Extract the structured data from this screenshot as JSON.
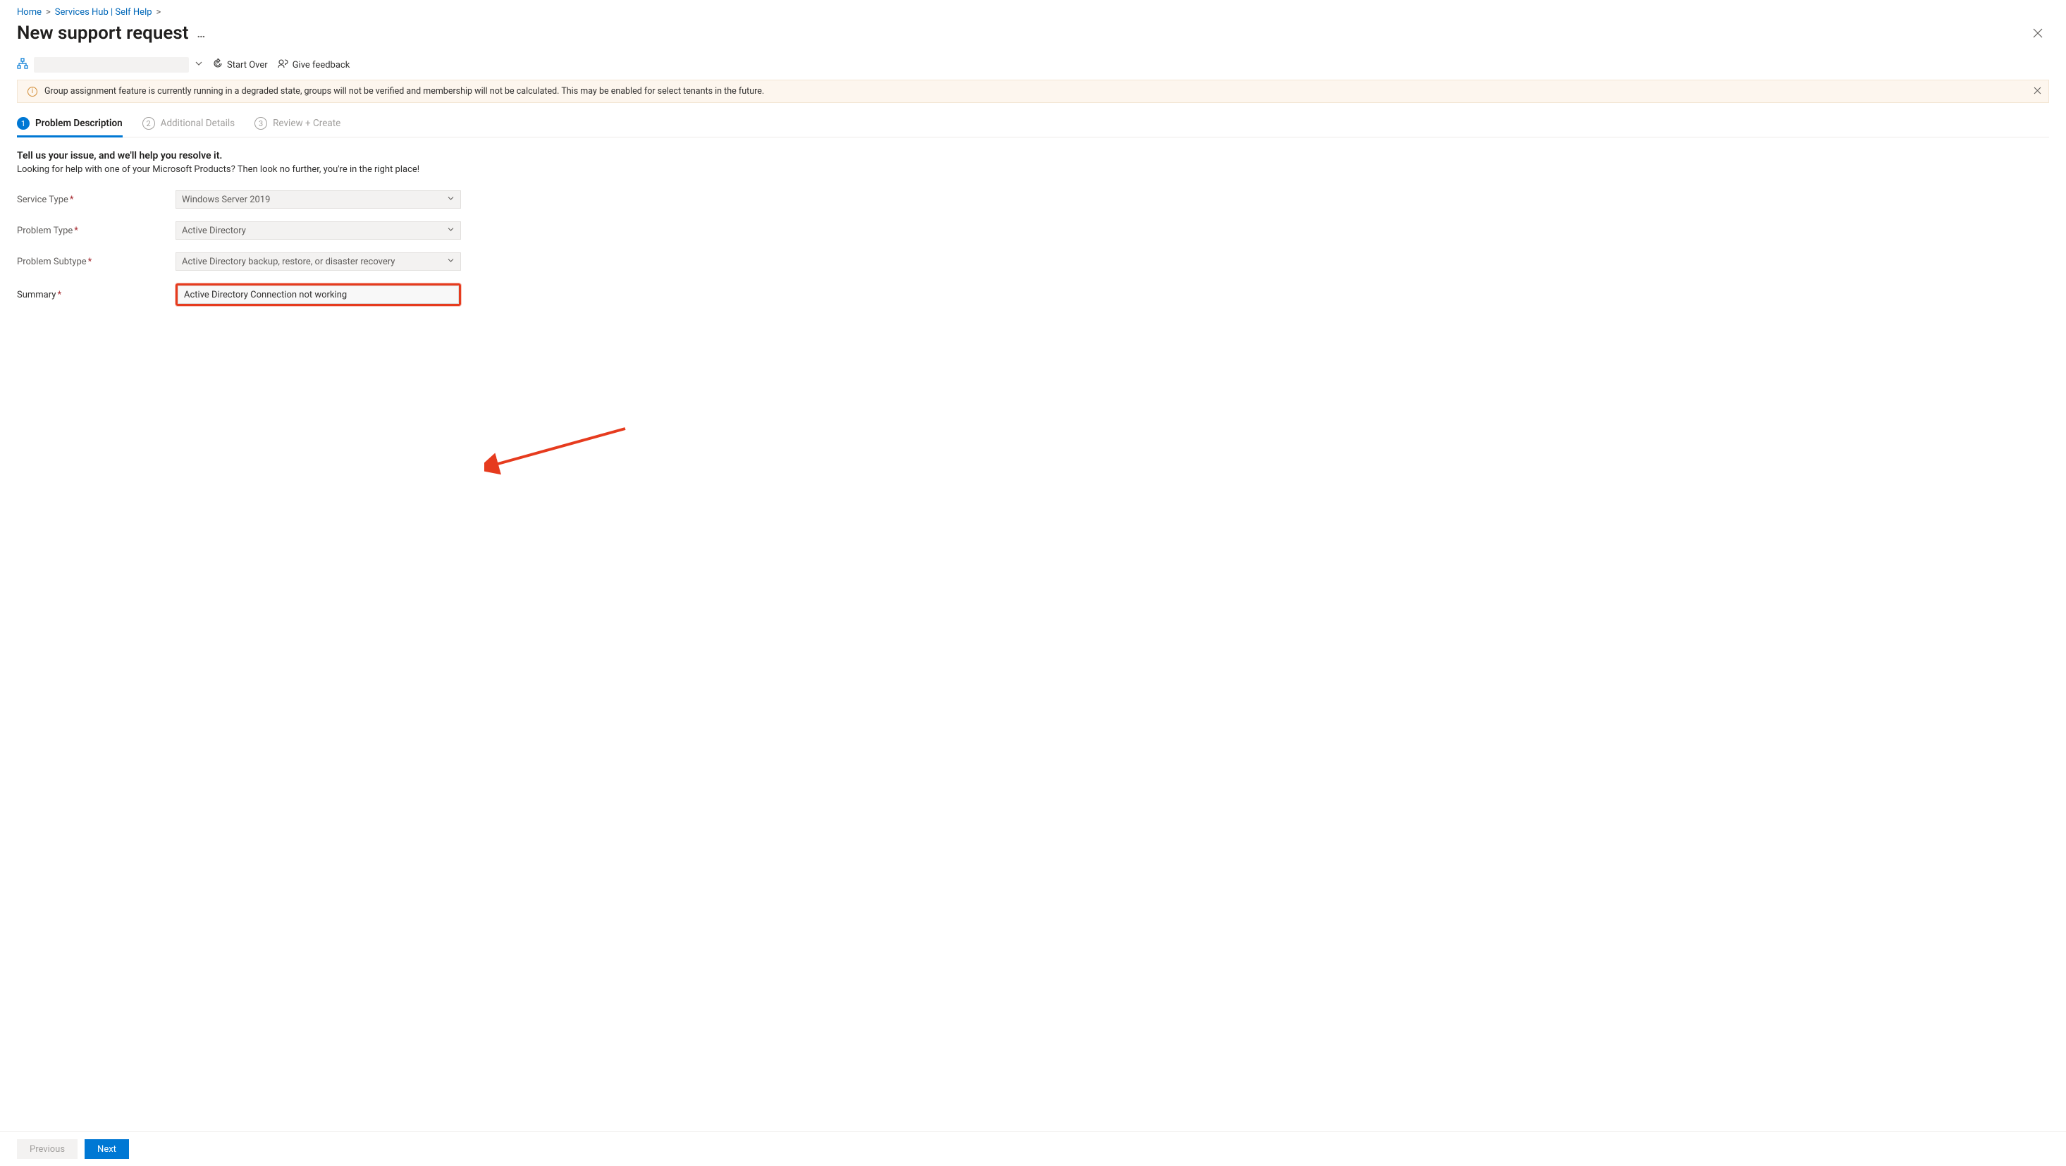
{
  "breadcrumb": {
    "items": [
      "Home",
      "Services Hub | Self Help"
    ]
  },
  "page_title": "New support request",
  "toolbar": {
    "start_over": "Start Over",
    "give_feedback": "Give feedback"
  },
  "banner": {
    "text": "Group assignment feature is currently running in a degraded state, groups will not be verified and membership will not be calculated. This may be enabled for select tenants in the future."
  },
  "steps": [
    {
      "num": "1",
      "label": "Problem Description",
      "active": true
    },
    {
      "num": "2",
      "label": "Additional Details",
      "active": false
    },
    {
      "num": "3",
      "label": "Review + Create",
      "active": false
    }
  ],
  "intro": {
    "heading": "Tell us your issue, and we'll help you resolve it.",
    "sub": "Looking for help with one of your Microsoft Products? Then look no further, you're in the right place!"
  },
  "form": {
    "service_type": {
      "label": "Service Type",
      "value": "Windows Server 2019"
    },
    "problem_type": {
      "label": "Problem Type",
      "value": "Active Directory"
    },
    "problem_subtype": {
      "label": "Problem Subtype",
      "value": "Active Directory backup, restore, or disaster recovery"
    },
    "summary": {
      "label": "Summary",
      "value": "Active Directory Connection not working"
    }
  },
  "footer": {
    "previous": "Previous",
    "next": "Next"
  }
}
